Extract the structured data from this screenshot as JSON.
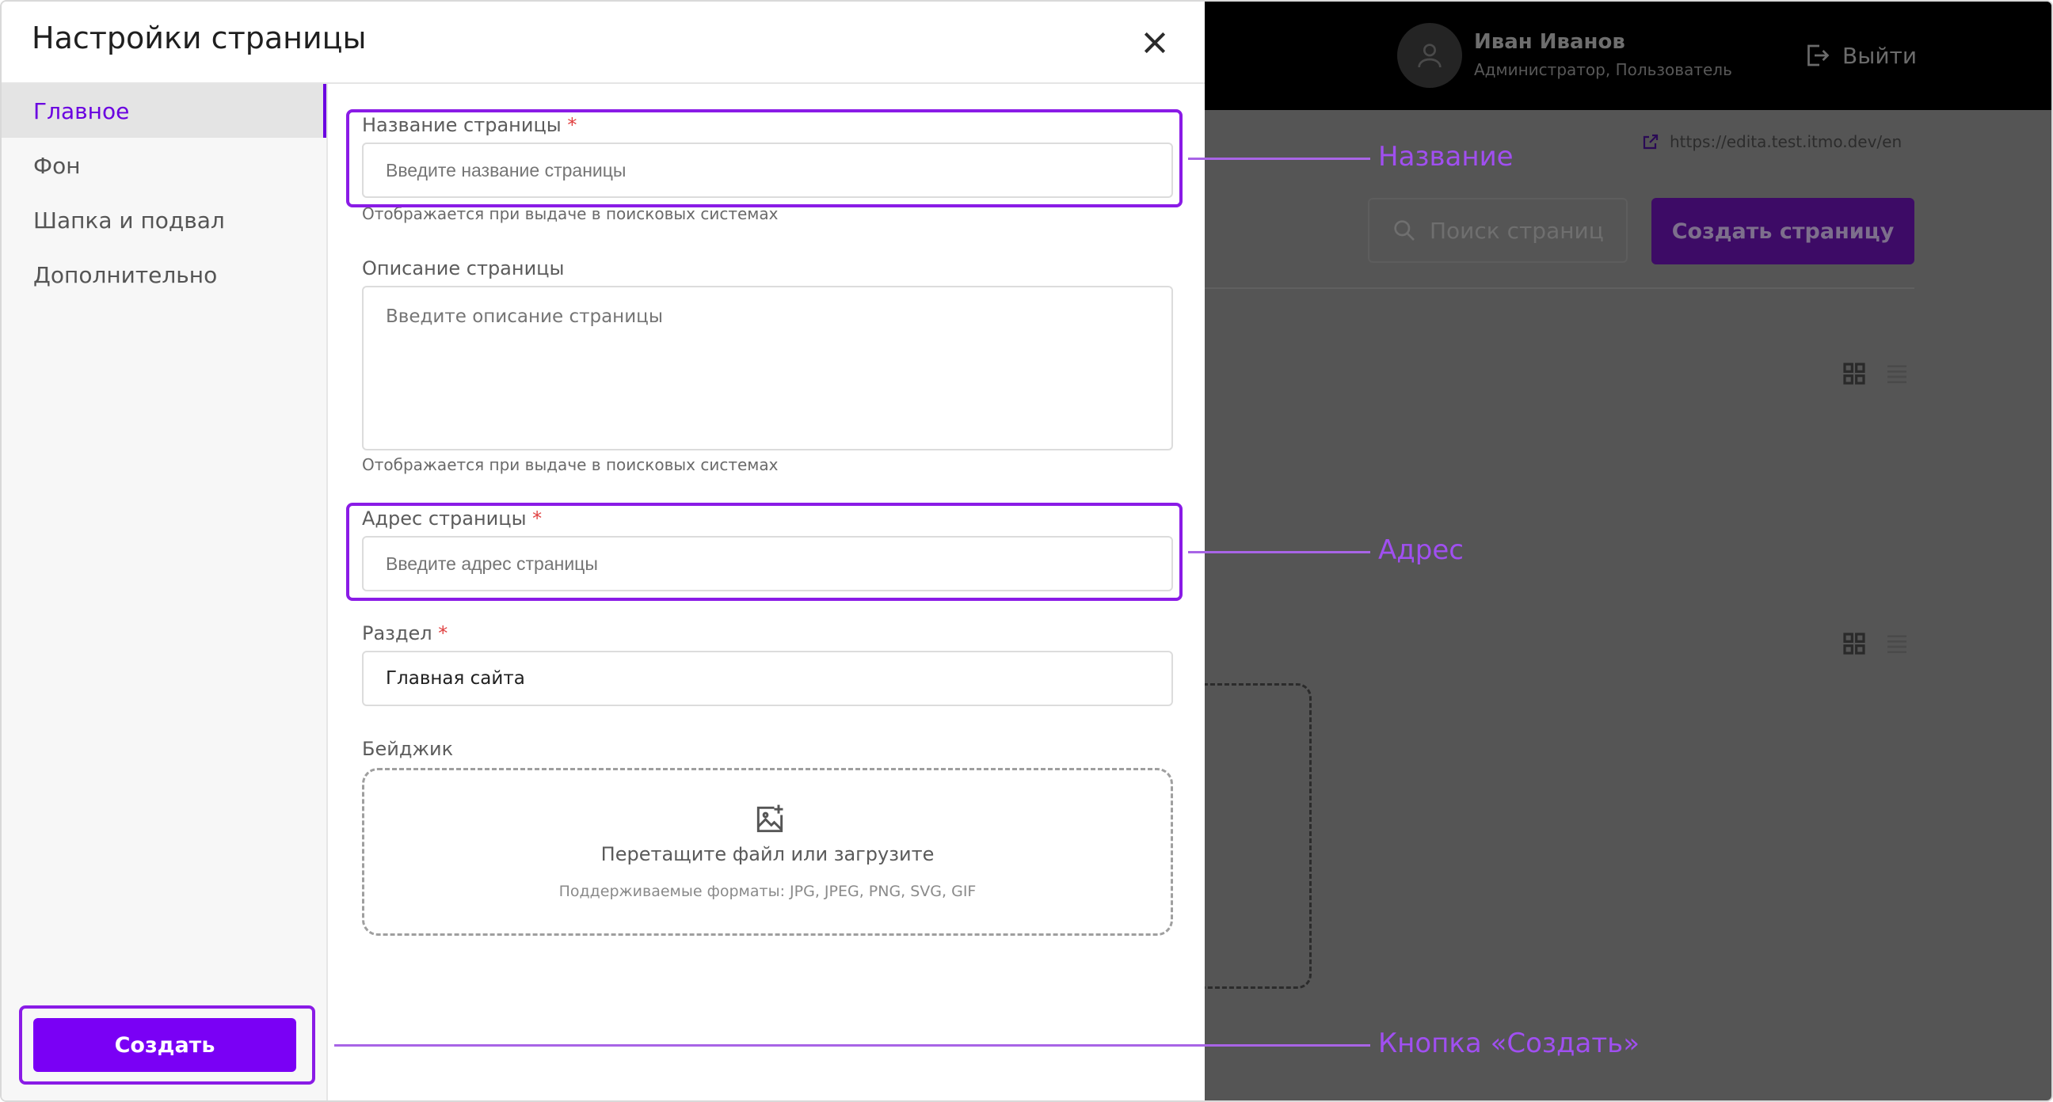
{
  "modal": {
    "title": "Настройки страницы",
    "close_icon": "close-icon"
  },
  "sidebar": {
    "items": [
      {
        "label": "Главное",
        "active": true
      },
      {
        "label": "Фон",
        "active": false
      },
      {
        "label": "Шапка и подвал",
        "active": false
      },
      {
        "label": "Дополнительно",
        "active": false
      }
    ]
  },
  "form": {
    "name": {
      "label": "Название страницы",
      "required_mark": "*",
      "placeholder": "Введите название страницы",
      "hint": "Отображается при выдаче в поисковых системах"
    },
    "description": {
      "label": "Описание страницы",
      "placeholder": "Введите описание страницы",
      "hint": "Отображается при выдаче в поисковых системах"
    },
    "address": {
      "label": "Адрес страницы",
      "required_mark": "*",
      "placeholder": "Введите адрес страницы"
    },
    "section": {
      "label": "Раздел",
      "required_mark": "*",
      "value": "Главная сайта"
    },
    "badge": {
      "label": "Бейджик",
      "upload_icon": "image-upload-icon",
      "dropzone_title": "Перетащите файл или загрузите",
      "dropzone_formats": "Поддерживаемые форматы: JPG, JPEG, PNG, SVG, GIF"
    }
  },
  "footer": {
    "create_label": "Создать"
  },
  "background_app": {
    "user_name": "Иван Иванов",
    "user_role": "Администратор, Пользователь",
    "logout_label": "Выйти",
    "site_url": "https://edita.test.itmo.dev/en",
    "search_placeholder": "Поиск страниц",
    "create_page_label": "Создать страницу"
  },
  "callouts": {
    "name": "Название",
    "address": "Адрес",
    "create_button": "Кнопка «Создать»"
  },
  "colors": {
    "accent": "#7a00f5",
    "highlight": "#8a1be6",
    "callout_text": "#a04ff0",
    "required": "#e04141",
    "overlay": "#555555"
  }
}
